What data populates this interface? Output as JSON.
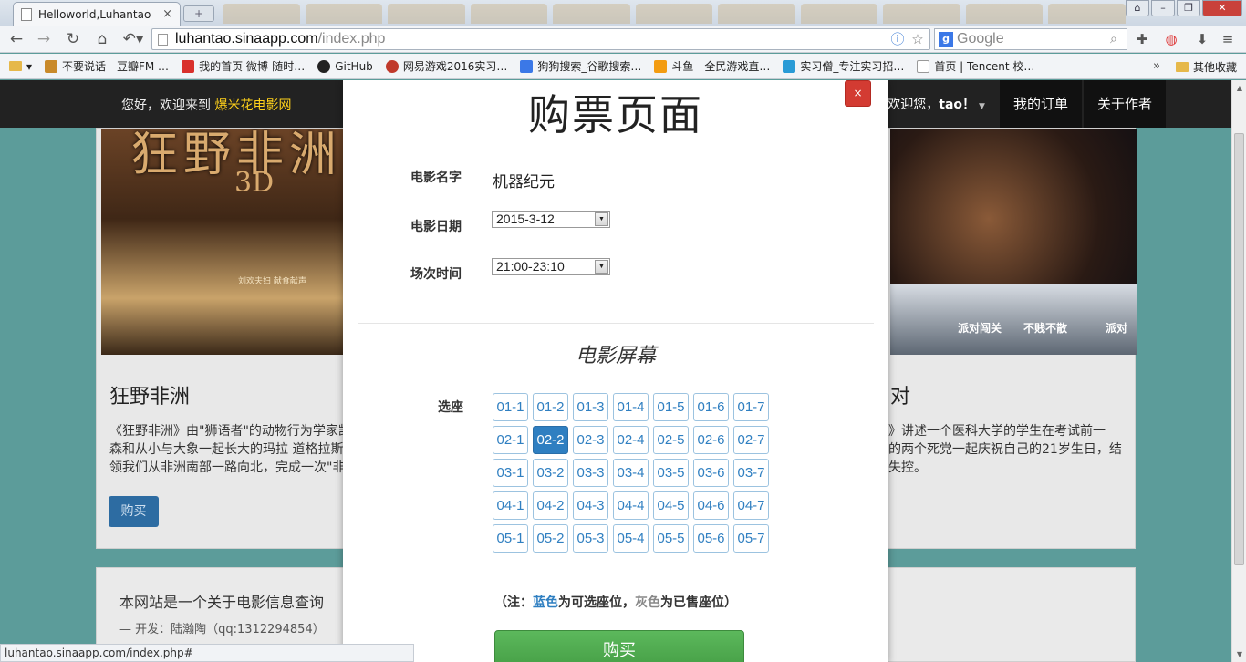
{
  "browser": {
    "tab_title": "Helloworld,Luhantao",
    "url_host": "luhantao.sinaapp.com",
    "url_path": "/index.php",
    "search_placeholder": "Google",
    "bookmarks": [
      {
        "label": "不要说话 - 豆瓣FM …",
        "color": "#c98a2a"
      },
      {
        "label": "我的首页 微博-随时…",
        "color": "#d9302c"
      },
      {
        "label": "GitHub",
        "color": "#222222"
      },
      {
        "label": "网易游戏2016实习…",
        "color": "#c0392b"
      },
      {
        "label": "狗狗搜索_谷歌搜索…",
        "color": "#3b78e7"
      },
      {
        "label": "斗鱼 - 全民游戏直…",
        "color": "#f39c12"
      },
      {
        "label": "实习僧_专注实习招…",
        "color": "#2a9bd6"
      },
      {
        "label": "首页 | Tencent 校…",
        "color": "#bbbbbb"
      }
    ],
    "bookmarks_more": "»",
    "bookmarks_other": "其他收藏",
    "status_url": "luhantao.sinaapp.com/index.php#"
  },
  "navbar": {
    "welcome_prefix": "您好，欢迎来到",
    "brand": "爆米花电影网",
    "user_greeting": "欢迎您，",
    "username": "tao！",
    "my_orders": "我的订单",
    "about_author": "关于作者"
  },
  "movies": [
    {
      "title": "狂野非洲",
      "description_lines": [
        "《狂野非洲》由\"狮语者\"的动物行为学家凯",
        "森和从小与大象一起长大的玛拉 道格拉斯",
        "领我们从非洲南部一路向北，完成一次\"非"
      ],
      "buy_label": "购买",
      "poster_title": "狂野非洲",
      "poster_3d": "3D",
      "poster_credit": "刘欢夫妇 献食献声"
    },
    {
      "title": "对",
      "description_lines": [
        "》讲述一个医科大学的学生在考试前一",
        "的两个死党一起庆祝自己的21岁生日，结",
        "失控。"
      ],
      "poster_tags": [
        "派对闯关",
        "不贱不散",
        "派对"
      ]
    }
  ],
  "footer": {
    "line1": "本网站是一个关于电影信息查询",
    "line2": "— 开发：陆瀚陶（qq:1312294854）"
  },
  "modal": {
    "title": "购票页面",
    "close": "×",
    "movie_name_label": "电影名字",
    "movie_name": "机器纪元",
    "date_label": "电影日期",
    "date_value": "2015-3-12",
    "time_label": "场次时间",
    "time_value": "21:00-23:10",
    "screen_title": "电影屏幕",
    "seat_label": "选座",
    "seat_rows": [
      [
        "01-1",
        "01-2",
        "01-3",
        "01-4",
        "01-5",
        "01-6",
        "01-7"
      ],
      [
        "02-1",
        "02-2",
        "02-3",
        "02-4",
        "02-5",
        "02-6",
        "02-7"
      ],
      [
        "03-1",
        "03-2",
        "03-3",
        "03-4",
        "03-5",
        "03-6",
        "03-7"
      ],
      [
        "04-1",
        "04-2",
        "04-3",
        "04-4",
        "04-5",
        "04-6",
        "04-7"
      ],
      [
        "05-1",
        "05-2",
        "05-3",
        "05-4",
        "05-5",
        "05-6",
        "05-7"
      ]
    ],
    "selected_seat": "02-2",
    "note_prefix": "（注：",
    "note_blue": "蓝色",
    "note_mid": "为可选座位，",
    "note_gray": "灰色",
    "note_suffix": "为已售座位）",
    "buy_label": "购买"
  },
  "colors": {
    "seat_available": "#2f7fc1",
    "seat_selected_bg": "#2f7fc1",
    "buy_green": "#5cb85c",
    "brand_yellow": "#ffd11a"
  }
}
